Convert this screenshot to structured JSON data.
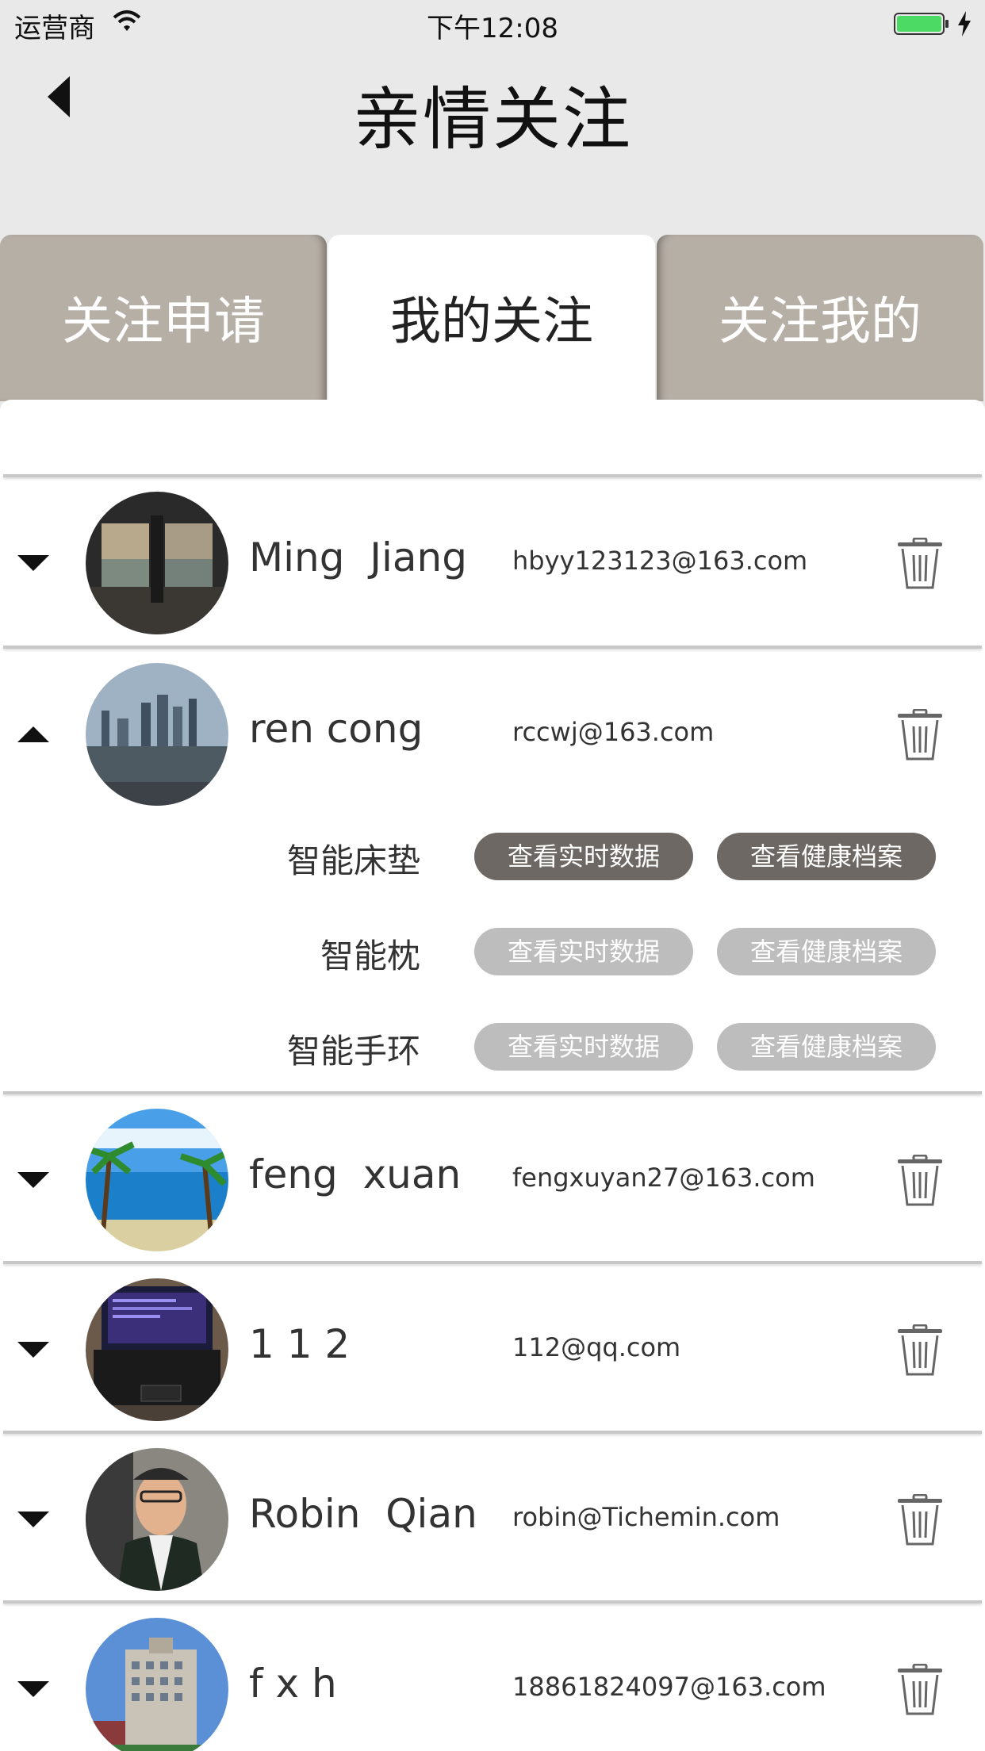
{
  "status_bar": {
    "carrier": "运营商",
    "time": "下午12:08",
    "battery_color": "#4cd964"
  },
  "nav": {
    "title": "亲情关注"
  },
  "tabs": [
    {
      "label": "关注申请",
      "selected": false
    },
    {
      "label": "我的关注",
      "selected": true
    },
    {
      "label": "关注我的",
      "selected": false
    }
  ],
  "contacts": [
    {
      "name": "Ming  Jiang",
      "email": "hbyy123123@163.com",
      "expanded": false,
      "avatar": "window-view-photo"
    },
    {
      "name": "ren cong",
      "email": "rccwj@163.com",
      "expanded": true,
      "avatar": "city-skyline-photo",
      "devices": [
        {
          "label": "智能床垫",
          "realtime": "查看实时数据",
          "health": "查看健康档案",
          "active": true
        },
        {
          "label": "智能枕",
          "realtime": "查看实时数据",
          "health": "查看健康档案",
          "active": false
        },
        {
          "label": "智能手环",
          "realtime": "查看实时数据",
          "health": "查看健康档案",
          "active": false
        }
      ]
    },
    {
      "name": "feng  xuan",
      "email": "fengxuyan27@163.com",
      "expanded": false,
      "avatar": "beach-photo"
    },
    {
      "name": "1 1 2",
      "email": "112@qq.com",
      "expanded": false,
      "avatar": "laptop-photo"
    },
    {
      "name": "Robin  Qian",
      "email": "robin@Tichemin.com",
      "expanded": false,
      "avatar": "person-in-car-photo"
    },
    {
      "name": "f x h",
      "email": "18861824097@163.com",
      "expanded": false,
      "avatar": "building-photo"
    }
  ],
  "colors": {
    "tab_inactive": "#b6afa6",
    "pill_active": "#6d6863",
    "pill_inactive": "#bdbdbd",
    "background": "#e9e9e9"
  }
}
